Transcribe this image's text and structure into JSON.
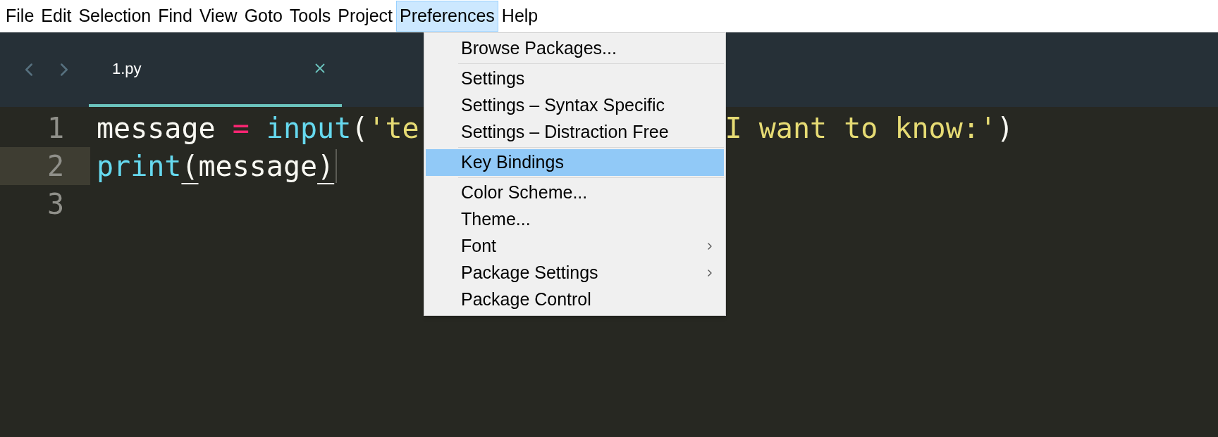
{
  "menu_bar": [
    {
      "label": "File",
      "selected": false
    },
    {
      "label": "Edit",
      "selected": false
    },
    {
      "label": "Selection",
      "selected": false
    },
    {
      "label": "Find",
      "selected": false
    },
    {
      "label": "View",
      "selected": false
    },
    {
      "label": "Goto",
      "selected": false
    },
    {
      "label": "Tools",
      "selected": false
    },
    {
      "label": "Project",
      "selected": false
    },
    {
      "label": "Preferences",
      "selected": true
    },
    {
      "label": "Help",
      "selected": false
    }
  ],
  "tabs": [
    {
      "label": "1.py",
      "selected": true
    }
  ],
  "editor": {
    "lines": [
      {
        "number": "1",
        "current": false,
        "segments": [
          [
            {
              "text": "message",
              "kind": "plain"
            },
            {
              "text": " = ",
              "kind": "operator"
            },
            {
              "text": "input",
              "kind": "builtin"
            },
            {
              "text": "(",
              "kind": "plain"
            },
            {
              "text": "'te",
              "kind": "string"
            }
          ],
          [
            {
              "text": "I want to know:'",
              "kind": "string"
            },
            {
              "text": ")",
              "kind": "plain"
            }
          ]
        ]
      },
      {
        "number": "2",
        "current": true,
        "segments": [
          [
            {
              "text": "print",
              "kind": "builtin"
            },
            {
              "text": "(",
              "kind": "match"
            },
            {
              "text": "message",
              "kind": "plain"
            },
            {
              "text": ")",
              "kind": "match"
            }
          ]
        ]
      },
      {
        "number": "3",
        "current": false
      }
    ]
  },
  "menu": {
    "items": [
      {
        "kind": "item",
        "label": "Browse Packages...",
        "selected": false,
        "submenu": false
      },
      {
        "kind": "separator"
      },
      {
        "kind": "item",
        "label": "Settings",
        "selected": false,
        "submenu": false
      },
      {
        "kind": "item",
        "label": "Settings – Syntax Specific",
        "selected": false,
        "submenu": false
      },
      {
        "kind": "item",
        "label": "Settings – Distraction Free",
        "selected": false,
        "submenu": false
      },
      {
        "kind": "separator"
      },
      {
        "kind": "item",
        "label": "Key Bindings",
        "selected": true,
        "submenu": false
      },
      {
        "kind": "separator"
      },
      {
        "kind": "item",
        "label": "Color Scheme...",
        "selected": false,
        "submenu": false
      },
      {
        "kind": "item",
        "label": "Theme...",
        "selected": false,
        "submenu": false
      },
      {
        "kind": "item",
        "label": "Font",
        "selected": false,
        "submenu": true
      },
      {
        "kind": "item",
        "label": "Package Settings",
        "selected": false,
        "submenu": true
      },
      {
        "kind": "item",
        "label": "Package Control",
        "selected": false,
        "submenu": false
      }
    ]
  }
}
